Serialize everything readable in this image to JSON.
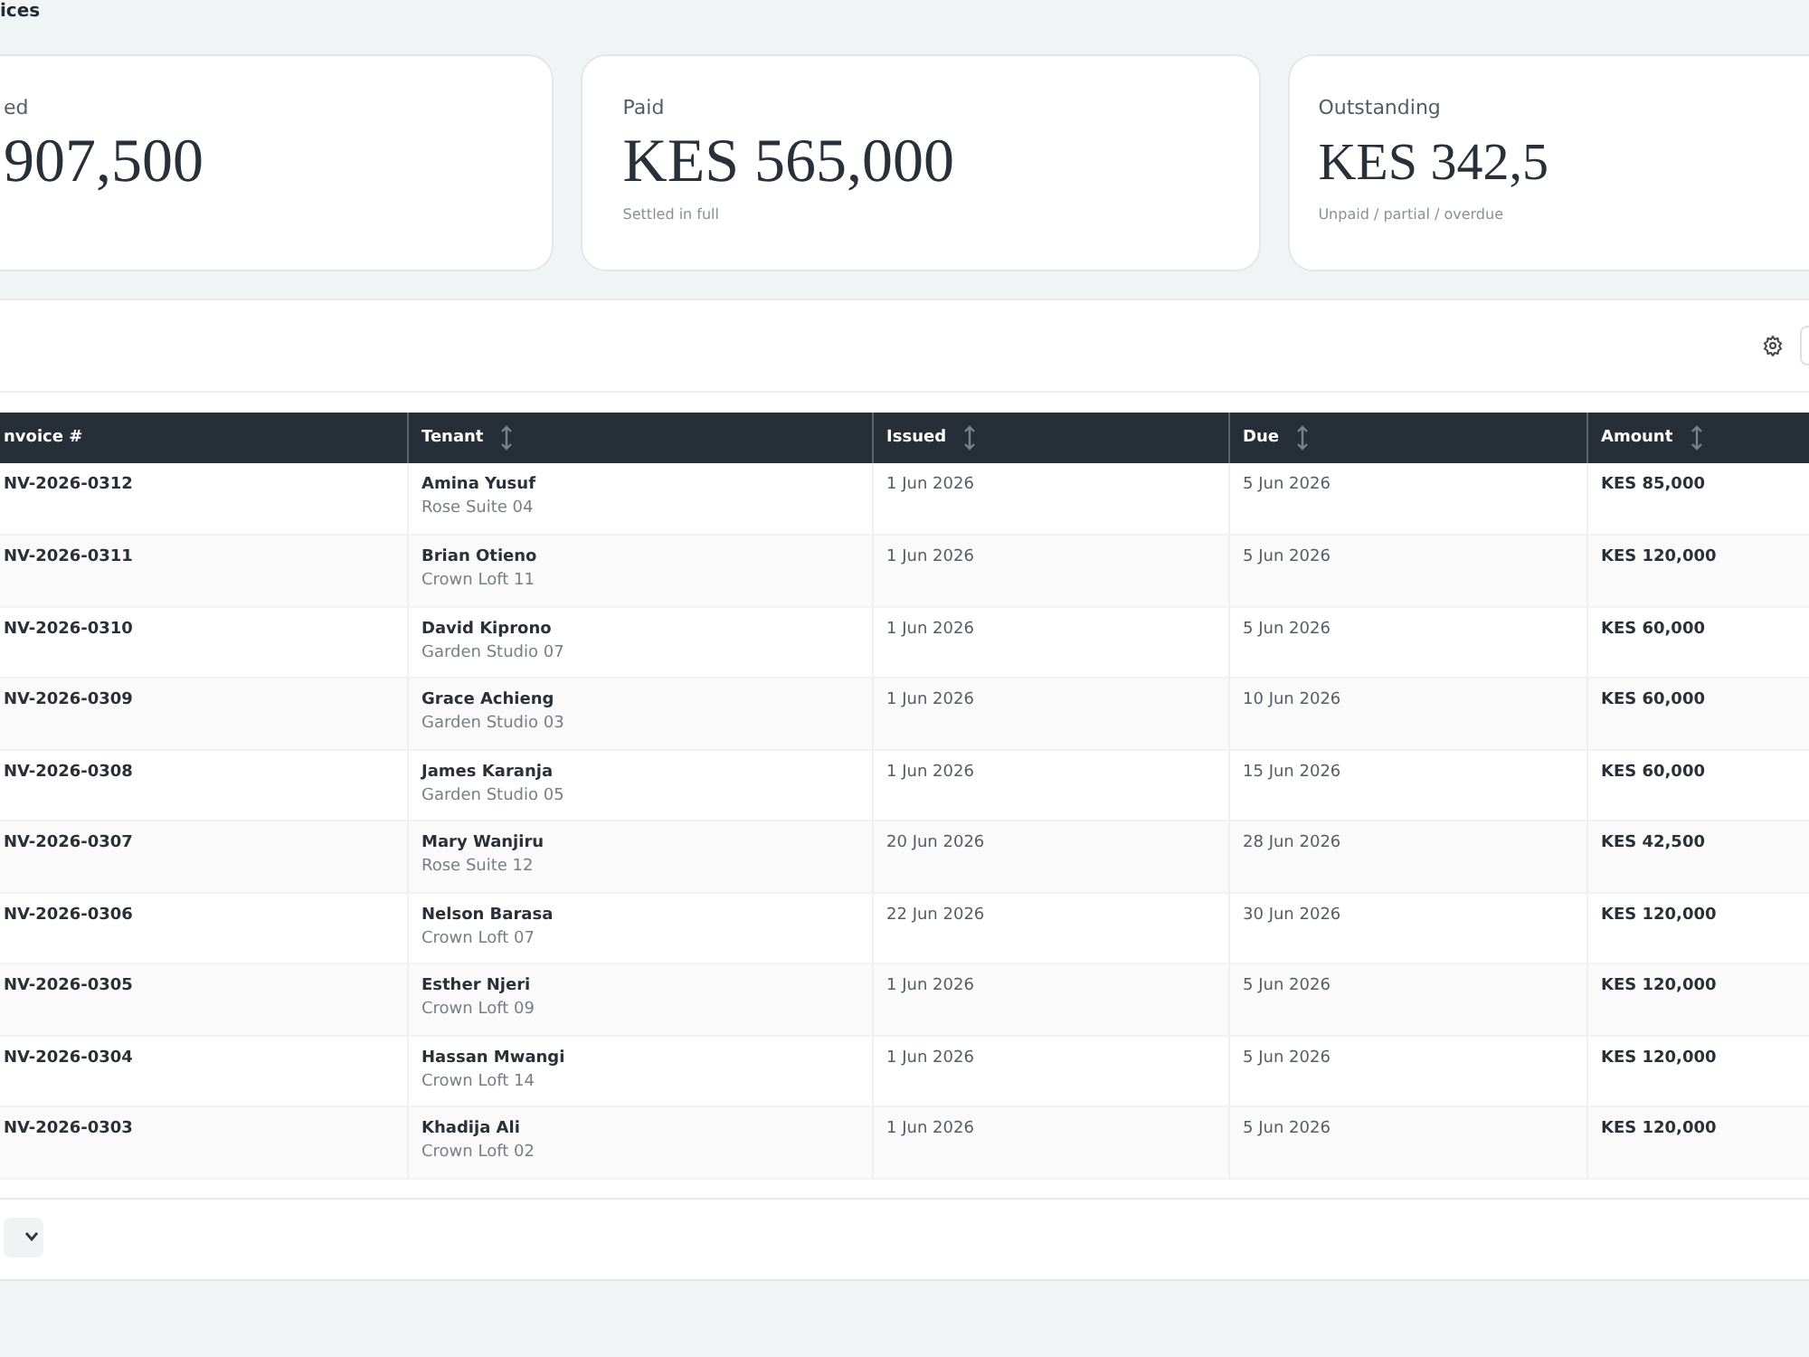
{
  "page": {
    "title": "ices"
  },
  "summary_cards": [
    {
      "label": "ed",
      "value": "907,500"
    },
    {
      "label": "Paid",
      "value": "KES 565,000",
      "note": "Settled in full"
    },
    {
      "label": "Outstanding",
      "value": "KES 342,5",
      "note": "Unpaid / partial / overdue"
    }
  ],
  "table": {
    "columns": [
      {
        "label": "nvoice #",
        "sortable": false
      },
      {
        "label": "Tenant",
        "sortable": true
      },
      {
        "label": "Issued",
        "sortable": true
      },
      {
        "label": "Due",
        "sortable": true
      },
      {
        "label": "Amount",
        "sortable": true
      }
    ],
    "rows": [
      {
        "invoice": "NV-2026-0312",
        "tenant": "Amina Yusuf",
        "unit": "Rose Suite 04",
        "issued": "1 Jun 2026",
        "due": "5 Jun 2026",
        "amount": "KES 85,000"
      },
      {
        "invoice": "NV-2026-0311",
        "tenant": "Brian Otieno",
        "unit": "Crown Loft 11",
        "issued": "1 Jun 2026",
        "due": "5 Jun 2026",
        "amount": "KES 120,000"
      },
      {
        "invoice": "NV-2026-0310",
        "tenant": "David Kiprono",
        "unit": "Garden Studio 07",
        "issued": "1 Jun 2026",
        "due": "5 Jun 2026",
        "amount": "KES 60,000"
      },
      {
        "invoice": "NV-2026-0309",
        "tenant": "Grace Achieng",
        "unit": "Garden Studio 03",
        "issued": "1 Jun 2026",
        "due": "10 Jun 2026",
        "amount": "KES 60,000"
      },
      {
        "invoice": "NV-2026-0308",
        "tenant": "James Karanja",
        "unit": "Garden Studio 05",
        "issued": "1 Jun 2026",
        "due": "15 Jun 2026",
        "amount": "KES 60,000"
      },
      {
        "invoice": "NV-2026-0307",
        "tenant": "Mary Wanjiru",
        "unit": "Rose Suite 12",
        "issued": "20 Jun 2026",
        "due": "28 Jun 2026",
        "amount": "KES 42,500"
      },
      {
        "invoice": "NV-2026-0306",
        "tenant": "Nelson Barasa",
        "unit": "Crown Loft 07",
        "issued": "22 Jun 2026",
        "due": "30 Jun 2026",
        "amount": "KES 120,000"
      },
      {
        "invoice": "NV-2026-0305",
        "tenant": "Esther Njeri",
        "unit": "Crown Loft 09",
        "issued": "1 Jun 2026",
        "due": "5 Jun 2026",
        "amount": "KES 120,000"
      },
      {
        "invoice": "NV-2026-0304",
        "tenant": "Hassan Mwangi",
        "unit": "Crown Loft 14",
        "issued": "1 Jun 2026",
        "due": "5 Jun 2026",
        "amount": "KES 120,000"
      },
      {
        "invoice": "NV-2026-0303",
        "tenant": "Khadija Ali",
        "unit": "Crown Loft 02",
        "issued": "1 Jun 2026",
        "due": "5 Jun 2026",
        "amount": "KES 120,000"
      }
    ]
  }
}
